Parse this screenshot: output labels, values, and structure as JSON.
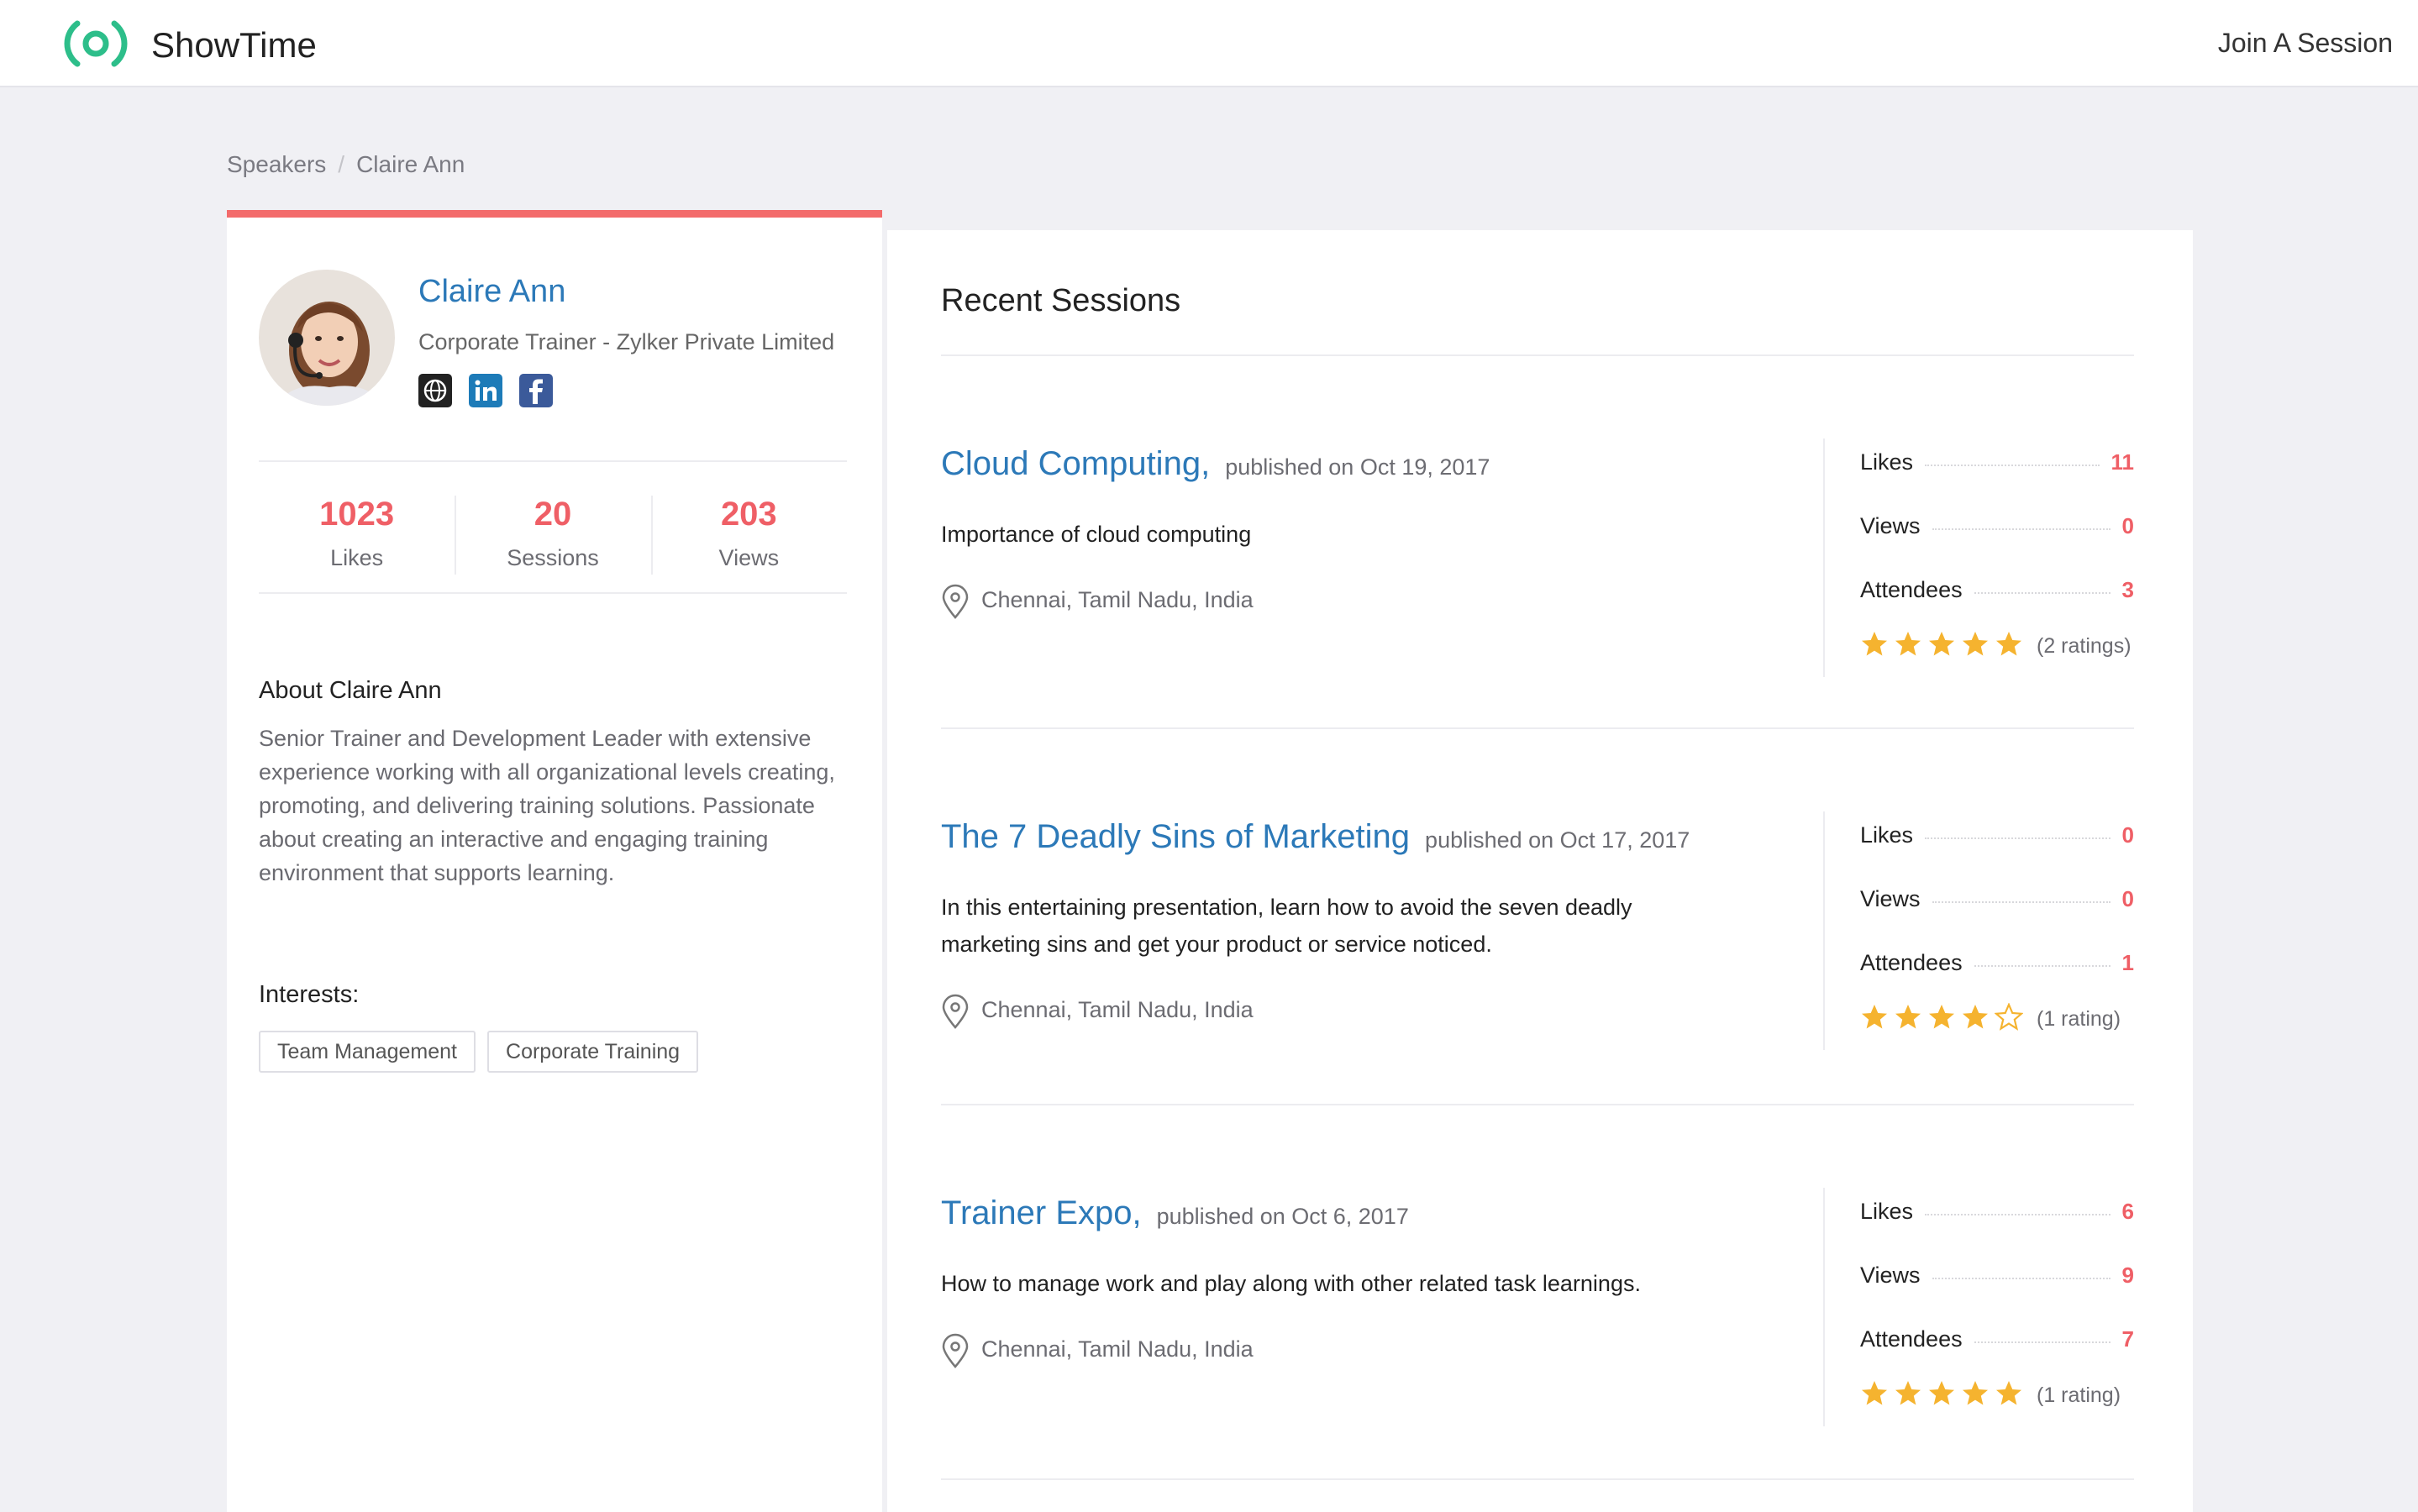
{
  "header": {
    "brand": "ShowTime",
    "join_link": "Join A Session",
    "brand_color": "#2dbe8a"
  },
  "breadcrumb": {
    "items": [
      "Speakers",
      "Claire Ann"
    ],
    "separator": "/"
  },
  "profile": {
    "name": "Claire Ann",
    "title": "Corporate Trainer - Zylker Private Limited",
    "social_icons": [
      "globe-icon",
      "linkedin-icon",
      "facebook-icon"
    ],
    "stats": [
      {
        "value": "1023",
        "label": "Likes"
      },
      {
        "value": "20",
        "label": "Sessions"
      },
      {
        "value": "203",
        "label": "Views"
      }
    ],
    "about_title": "About Claire Ann",
    "about_text": "Senior Trainer and Development Leader with extensive experience working with all organizational levels creating, promoting, and delivering training solutions. Passionate about creating an interactive and engaging training environment that supports learning.",
    "interests_title": "Interests:",
    "interests": [
      "Team Management",
      "Corporate Training"
    ],
    "accent_color": "#f36b6b"
  },
  "sessions": {
    "title": "Recent Sessions",
    "items": [
      {
        "title": "Cloud Computing,",
        "date": "published on Oct 19, 2017",
        "description": "Importance of cloud computing",
        "location": "Chennai, Tamil Nadu, India",
        "likes_label": "Likes",
        "likes": "11",
        "views_label": "Views",
        "views": "0",
        "attendees_label": "Attendees",
        "attendees": "3",
        "stars": 5,
        "ratings_text": "(2 ratings)"
      },
      {
        "title": "The 7 Deadly Sins of Marketing",
        "date": "published on Oct 17, 2017",
        "description": "In this entertaining presentation, learn how to avoid the seven deadly marketing sins and get your product or service noticed.",
        "location": "Chennai, Tamil Nadu, India",
        "likes_label": "Likes",
        "likes": "0",
        "views_label": "Views",
        "views": "0",
        "attendees_label": "Attendees",
        "attendees": "1",
        "stars": 4,
        "ratings_text": "(1 rating)"
      },
      {
        "title": "Trainer Expo,",
        "date": "published on Oct 6, 2017",
        "description": "How to manage work and play along with other related task learnings.",
        "location": "Chennai, Tamil Nadu, India",
        "likes_label": "Likes",
        "likes": "6",
        "views_label": "Views",
        "views": "9",
        "attendees_label": "Attendees",
        "attendees": "7",
        "stars": 5,
        "ratings_text": "(1 rating)"
      }
    ]
  }
}
